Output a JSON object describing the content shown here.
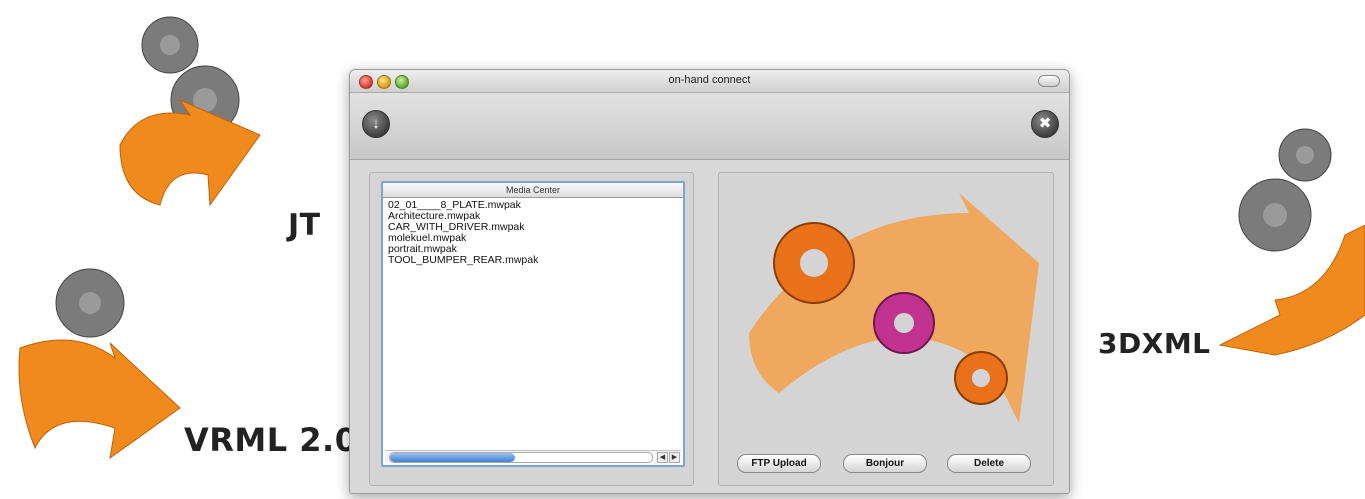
{
  "formats": {
    "jt": "JT",
    "vrml": "VRML 2.0",
    "dxml": "3DXML"
  },
  "window": {
    "title": "on-hand connect"
  },
  "toolbar": {
    "download_icon": "download-icon",
    "settings_icon": "settings-icon"
  },
  "media_center": {
    "header": "Media Center",
    "files": [
      "02_01____8_PLATE.mwpak",
      "Architecture.mwpak",
      "CAR_WITH_DRIVER.mwpak",
      "molekuel.mwpak",
      "portrait.mwpak",
      "TOOL_BUMPER_REAR.mwpak"
    ]
  },
  "buttons": {
    "ftp_upload": "FTP Upload",
    "bonjour": "Bonjour",
    "delete": "Delete"
  },
  "colors": {
    "orange": "#f08a1c",
    "magenta": "#c2338f",
    "gear_gray": "#7a7a7a"
  }
}
